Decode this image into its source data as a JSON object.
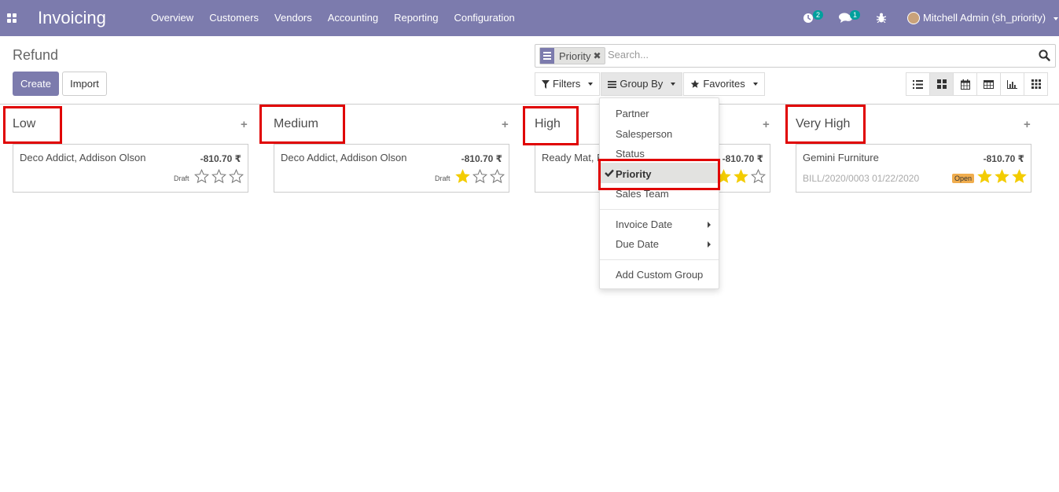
{
  "navbar": {
    "app_title": "Invoicing",
    "menu": [
      "Overview",
      "Customers",
      "Vendors",
      "Accounting",
      "Reporting",
      "Configuration"
    ],
    "activity_count": "2",
    "messages_count": "1",
    "user": "Mitchell Admin (sh_priority)"
  },
  "control_panel": {
    "breadcrumb": "Refund",
    "create_label": "Create",
    "import_label": "Import",
    "search": {
      "facet": "Priority",
      "placeholder": "Search..."
    },
    "filters_label": "Filters",
    "groupby_label": "Group By",
    "favorites_label": "Favorites"
  },
  "groupby_menu": {
    "items": [
      "Partner",
      "Salesperson",
      "Status",
      "Priority",
      "Sales Team"
    ],
    "checked": "Priority",
    "date_items": [
      "Invoice Date",
      "Due Date"
    ],
    "custom": "Add Custom Group"
  },
  "kanban": {
    "columns": [
      {
        "title": "Low",
        "card": {
          "partner": "Deco Addict, Addison Olson",
          "amount": "-810.70 ₹",
          "ref": "",
          "state": "Draft",
          "stars": 0
        }
      },
      {
        "title": "Medium",
        "card": {
          "partner": "Deco Addict, Addison Olson",
          "amount": "-810.70 ₹",
          "ref": "",
          "state": "Draft",
          "stars": 1
        }
      },
      {
        "title": "High",
        "card": {
          "partner": "Ready Mat, Pa",
          "amount": "-810.70 ₹",
          "ref": "",
          "state": "",
          "stars": 2
        }
      },
      {
        "title": "Very High",
        "card": {
          "partner": "Gemini Furniture",
          "amount": "-810.70 ₹",
          "ref": "BILL/2020/0003 01/22/2020",
          "state": "Open",
          "stars": 3
        }
      }
    ]
  },
  "colors": {
    "brand": "#7c7bad",
    "highlight": "#e00000",
    "star_filled": "#f3cc00",
    "badge": "#00a09d"
  }
}
